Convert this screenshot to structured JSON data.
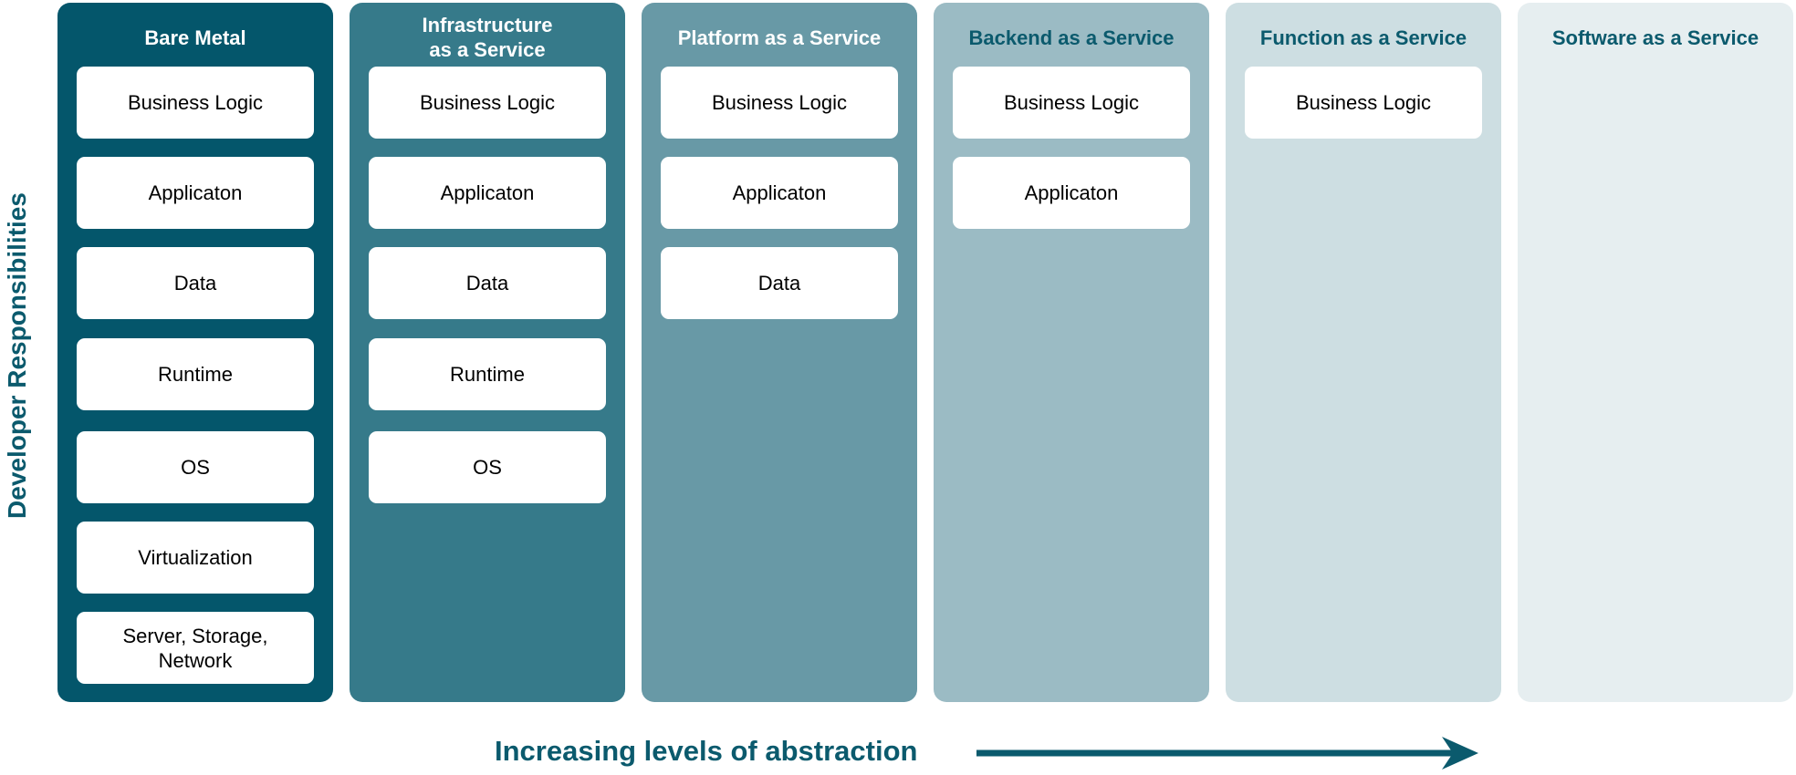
{
  "y_axis_label": "Developer Responsibilities",
  "x_axis_label": "Increasing levels of abstraction",
  "colors": {
    "accent_text": "#0b5a6d",
    "arrow": "#0b5a6d"
  },
  "columns": [
    {
      "title": "Bare Metal",
      "bg": "#04566b",
      "title_color": "#ffffff",
      "items": [
        "Business Logic",
        "Applicaton",
        "Data",
        "Runtime",
        "OS",
        "Virtualization",
        "Server, Storage,\nNetwork"
      ]
    },
    {
      "title": "Infrastructure\nas a Service",
      "bg": "#367a8a",
      "title_color": "#ffffff",
      "items": [
        "Business Logic",
        "Applicaton",
        "Data",
        "Runtime",
        "OS"
      ]
    },
    {
      "title": "Platform as a Service",
      "bg": "#6899a6",
      "title_color": "#ffffff",
      "items": [
        "Business Logic",
        "Applicaton",
        "Data"
      ]
    },
    {
      "title": "Backend as a Service",
      "bg": "#9bbbc4",
      "title_color": "#0b5a6d",
      "items": [
        "Business Logic",
        "Applicaton"
      ]
    },
    {
      "title": "Function as a Service",
      "bg": "#cddee2",
      "title_color": "#0b5a6d",
      "items": [
        "Business Logic"
      ]
    },
    {
      "title": "Software as a Service",
      "bg": "#e6eef0",
      "title_color": "#0b5a6d",
      "items": []
    }
  ]
}
